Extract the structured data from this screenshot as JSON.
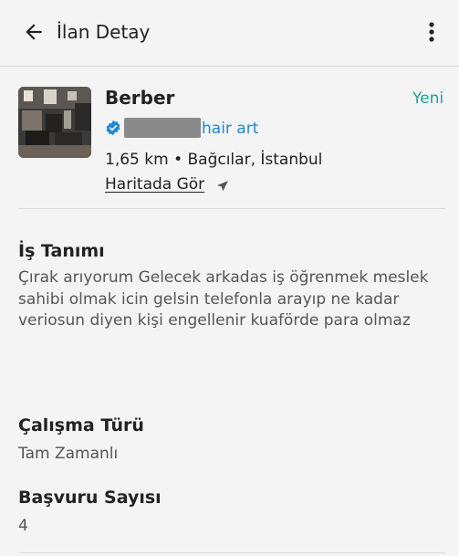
{
  "header": {
    "title": "İlan Detay"
  },
  "job": {
    "title": "Berber",
    "badge": "Yeni",
    "company": "hair art",
    "location": "1,65 km • Bağcılar, İstanbul",
    "map_link": "Haritada Gör",
    "colors": {
      "accent_green": "#1aa394",
      "link_blue": "#1e88d6"
    }
  },
  "description": {
    "heading": "İş Tanımı",
    "text": "Çırak arıyorum Gelecek arkadas iş öğrenmek meslek sahibi olmak icin gelsin telefonla arayıp ne kadar veriosun diyen kişi engellenir kuaförde para olmaz"
  },
  "work_type": {
    "heading": "Çalışma Türü",
    "value": "Tam Zamanlı"
  },
  "applications": {
    "heading": "Başvuru Sayısı",
    "value": "4"
  },
  "icons": [
    "arrow-left-icon",
    "more-vertical-icon",
    "verified-check-icon",
    "navigation-arrow-icon"
  ]
}
